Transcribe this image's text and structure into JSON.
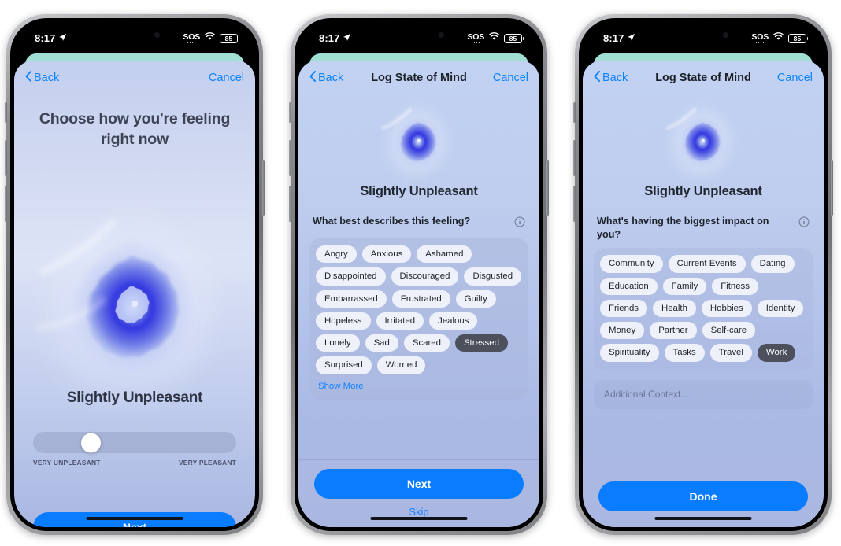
{
  "status_bar": {
    "time": "8:17",
    "location_icon": "location-arrow-icon",
    "sos_label": "SOS",
    "wifi_icon": "wifi-icon",
    "battery_level": "85"
  },
  "colors": {
    "accent_blue": "#0a7cff",
    "link_blue": "#1480ff",
    "chip_bg": "#eef1fa",
    "chip_selected_bg": "#4b505c",
    "teal_strip": "#9fdfd3"
  },
  "screens": [
    {
      "id": "choose-feeling",
      "nav": {
        "back_label": "Back",
        "title": "",
        "cancel_label": "Cancel"
      },
      "heading": "Choose how you're feeling right now",
      "mood_label": "Slightly Unpleasant",
      "slider": {
        "min_label": "VERY UNPLEASANT",
        "max_label": "VERY PLEASANT",
        "value_percent": 25
      },
      "primary_button": "Next"
    },
    {
      "id": "describe-feeling",
      "nav": {
        "back_label": "Back",
        "title": "Log State of Mind",
        "cancel_label": "Cancel"
      },
      "mood_label": "Slightly Unpleasant",
      "question": "What best describes this feeling?",
      "info_icon": "info-circle-icon",
      "chips": [
        {
          "label": "Angry",
          "selected": false
        },
        {
          "label": "Anxious",
          "selected": false
        },
        {
          "label": "Ashamed",
          "selected": false
        },
        {
          "label": "Disappointed",
          "selected": false
        },
        {
          "label": "Discouraged",
          "selected": false
        },
        {
          "label": "Disgusted",
          "selected": false
        },
        {
          "label": "Embarrassed",
          "selected": false
        },
        {
          "label": "Frustrated",
          "selected": false
        },
        {
          "label": "Guilty",
          "selected": false
        },
        {
          "label": "Hopeless",
          "selected": false
        },
        {
          "label": "Irritated",
          "selected": false
        },
        {
          "label": "Jealous",
          "selected": false
        },
        {
          "label": "Lonely",
          "selected": false
        },
        {
          "label": "Sad",
          "selected": false
        },
        {
          "label": "Scared",
          "selected": false
        },
        {
          "label": "Stressed",
          "selected": true
        },
        {
          "label": "Surprised",
          "selected": false
        },
        {
          "label": "Worried",
          "selected": false
        }
      ],
      "show_more_label": "Show More",
      "primary_button": "Next",
      "secondary_button": "Skip"
    },
    {
      "id": "biggest-impact",
      "nav": {
        "back_label": "Back",
        "title": "Log State of Mind",
        "cancel_label": "Cancel"
      },
      "mood_label": "Slightly Unpleasant",
      "question": "What's having the biggest impact on you?",
      "info_icon": "info-circle-icon",
      "chips": [
        {
          "label": "Community",
          "selected": false
        },
        {
          "label": "Current Events",
          "selected": false
        },
        {
          "label": "Dating",
          "selected": false
        },
        {
          "label": "Education",
          "selected": false
        },
        {
          "label": "Family",
          "selected": false
        },
        {
          "label": "Fitness",
          "selected": false
        },
        {
          "label": "Friends",
          "selected": false
        },
        {
          "label": "Health",
          "selected": false
        },
        {
          "label": "Hobbies",
          "selected": false
        },
        {
          "label": "Identity",
          "selected": false
        },
        {
          "label": "Money",
          "selected": false
        },
        {
          "label": "Partner",
          "selected": false
        },
        {
          "label": "Self-care",
          "selected": false
        },
        {
          "label": "Spirituality",
          "selected": false
        },
        {
          "label": "Tasks",
          "selected": false
        },
        {
          "label": "Travel",
          "selected": false
        },
        {
          "label": "Work",
          "selected": true
        }
      ],
      "context_placeholder": "Additional Context...",
      "context_value": "",
      "primary_button": "Done"
    }
  ]
}
